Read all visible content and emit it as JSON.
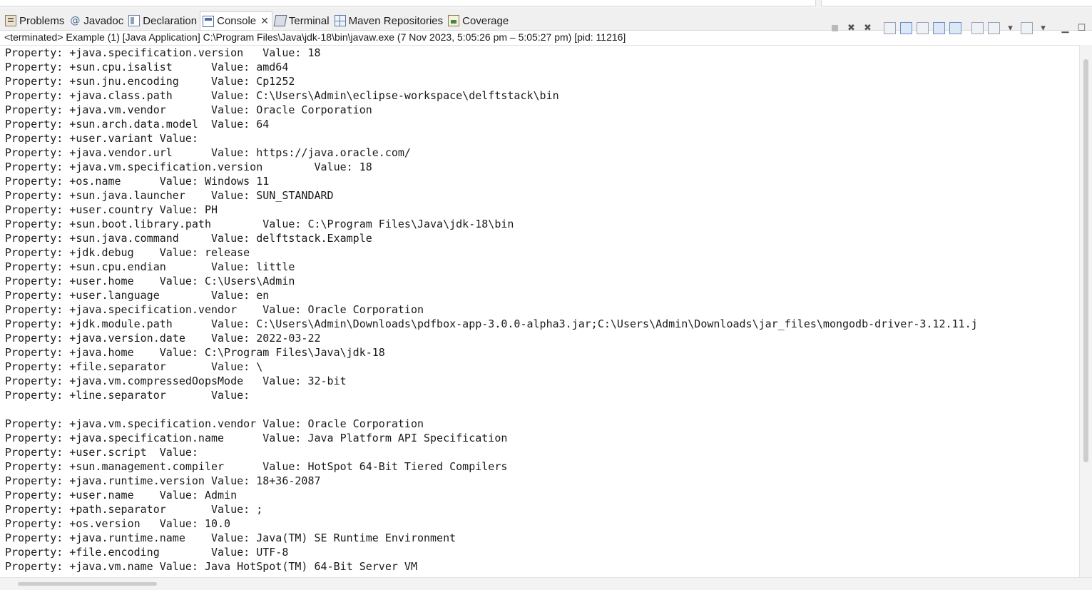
{
  "tabs": [
    {
      "label": "Problems",
      "icon": "problems-icon"
    },
    {
      "label": "Javadoc",
      "icon": "javadoc-icon"
    },
    {
      "label": "Declaration",
      "icon": "declaration-icon"
    },
    {
      "label": "Console",
      "icon": "console-icon",
      "active": true
    },
    {
      "label": "Terminal",
      "icon": "terminal-icon"
    },
    {
      "label": "Maven Repositories",
      "icon": "maven-icon"
    },
    {
      "label": "Coverage",
      "icon": "coverage-icon"
    }
  ],
  "status_line": "<terminated> Example (1) [Java Application] C:\\Program Files\\Java\\jdk-18\\bin\\javaw.exe  (7 Nov 2023, 5:05:26 pm – 5:05:27 pm) [pid: 11216]",
  "console_lines": [
    "Property: +java.specification.version   Value: 18",
    "Property: +sun.cpu.isalist      Value: amd64",
    "Property: +sun.jnu.encoding     Value: Cp1252",
    "Property: +java.class.path      Value: C:\\Users\\Admin\\eclipse-workspace\\delftstack\\bin",
    "Property: +java.vm.vendor       Value: Oracle Corporation",
    "Property: +sun.arch.data.model  Value: 64",
    "Property: +user.variant Value: ",
    "Property: +java.vendor.url      Value: https://java.oracle.com/",
    "Property: +java.vm.specification.version        Value: 18",
    "Property: +os.name      Value: Windows 11",
    "Property: +sun.java.launcher    Value: SUN_STANDARD",
    "Property: +user.country Value: PH",
    "Property: +sun.boot.library.path        Value: C:\\Program Files\\Java\\jdk-18\\bin",
    "Property: +sun.java.command     Value: delftstack.Example",
    "Property: +jdk.debug    Value: release",
    "Property: +sun.cpu.endian       Value: little",
    "Property: +user.home    Value: C:\\Users\\Admin",
    "Property: +user.language        Value: en",
    "Property: +java.specification.vendor    Value: Oracle Corporation",
    "Property: +jdk.module.path      Value: C:\\Users\\Admin\\Downloads\\pdfbox-app-3.0.0-alpha3.jar;C:\\Users\\Admin\\Downloads\\jar_files\\mongodb-driver-3.12.11.j",
    "Property: +java.version.date    Value: 2022-03-22",
    "Property: +java.home    Value: C:\\Program Files\\Java\\jdk-18",
    "Property: +file.separator       Value: \\",
    "Property: +java.vm.compressedOopsMode   Value: 32-bit",
    "Property: +line.separator       Value: ",
    "",
    "Property: +java.vm.specification.vendor Value: Oracle Corporation",
    "Property: +java.specification.name      Value: Java Platform API Specification",
    "Property: +user.script  Value: ",
    "Property: +sun.management.compiler      Value: HotSpot 64-Bit Tiered Compilers",
    "Property: +java.runtime.version Value: 18+36-2087",
    "Property: +user.name    Value: Admin",
    "Property: +path.separator       Value: ;",
    "Property: +os.version   Value: 10.0",
    "Property: +java.runtime.name    Value: Java(TM) SE Runtime Environment",
    "Property: +file.encoding        Value: UTF-8",
    "Property: +java.vm.name Value: Java HotSpot(TM) 64-Bit Server VM"
  ],
  "colors": {
    "accent": "#6d8fc6",
    "tabbar_bg": "#f0f0f0"
  }
}
